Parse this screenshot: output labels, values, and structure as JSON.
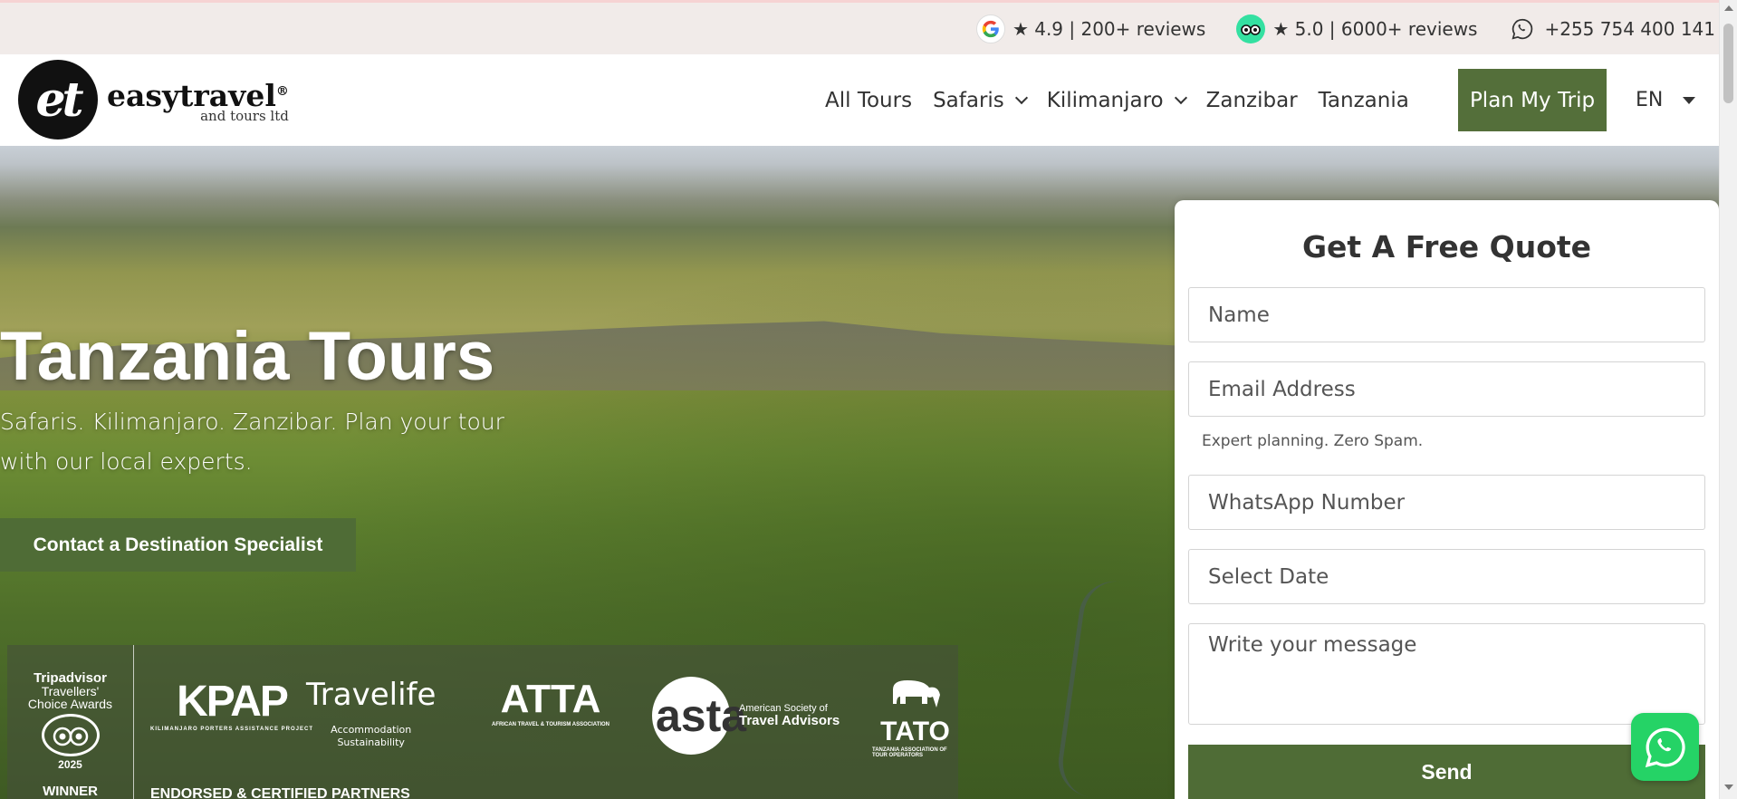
{
  "topbar": {
    "google_rating": "★ 4.9 | 200+ reviews",
    "tripadvisor_rating": "★ 5.0 | 6000+ reviews",
    "phone": "+255 754 400 141"
  },
  "logo": {
    "mark": "et",
    "name": "easytravel",
    "registered": "®",
    "sub": "and tours ltd"
  },
  "nav": {
    "items": [
      {
        "label": "All Tours"
      },
      {
        "label": "Safaris"
      },
      {
        "label": "Kilimanjaro"
      },
      {
        "label": "Zanzibar"
      },
      {
        "label": "Tanzania"
      }
    ],
    "cta": "Plan My Trip",
    "language": "EN"
  },
  "hero": {
    "title": "Tanzania Tours",
    "subtitle": "Safaris. Kilimanjaro. Zanzibar. Plan your tour with our local experts.",
    "cta": "Contact a Destination Specialist"
  },
  "badges": {
    "award": {
      "brand": "Tripadvisor",
      "line1": "Travellers'",
      "line2": "Choice Awards",
      "year": "2025",
      "status": "WINNER"
    },
    "partners": {
      "kpap": "KPAP",
      "kpap_sub": "KILIMANJARO PORTERS ASSISTANCE PROJECT",
      "travelife": "Travelife",
      "travelife_sub1": "Accommodation",
      "travelife_sub2": "Sustainability",
      "atta": "ATTA",
      "atta_sub": "AFRICAN TRAVEL & TOURISM ASSOCIATION",
      "asta": "asta",
      "asta_line1": "American Society of",
      "asta_line2": "Travel Advisors",
      "tato": "TATO",
      "tato_sub": "TANZANIA ASSOCIATION OF TOUR OPERATORS"
    },
    "endorsed_label": "ENDORSED & CERTIFIED PARTNERS"
  },
  "quote_form": {
    "title": "Get A Free Quote",
    "name_placeholder": "Name",
    "email_placeholder": "Email Address",
    "hint": "Expert planning. Zero Spam.",
    "whatsapp_placeholder": "WhatsApp Number",
    "date_placeholder": "Select Date",
    "message_placeholder": "Write your message",
    "send_label": "Send"
  },
  "colors": {
    "brand_green": "#546f3a",
    "topbar_bg": "#f1ebe9",
    "whatsapp_green": "#25d366",
    "tripadvisor_green": "#34e0a1"
  },
  "icons": {
    "google": "google-icon",
    "tripadvisor": "tripadvisor-icon",
    "whatsapp": "whatsapp-icon",
    "dropdown": "chevron-down-icon"
  }
}
